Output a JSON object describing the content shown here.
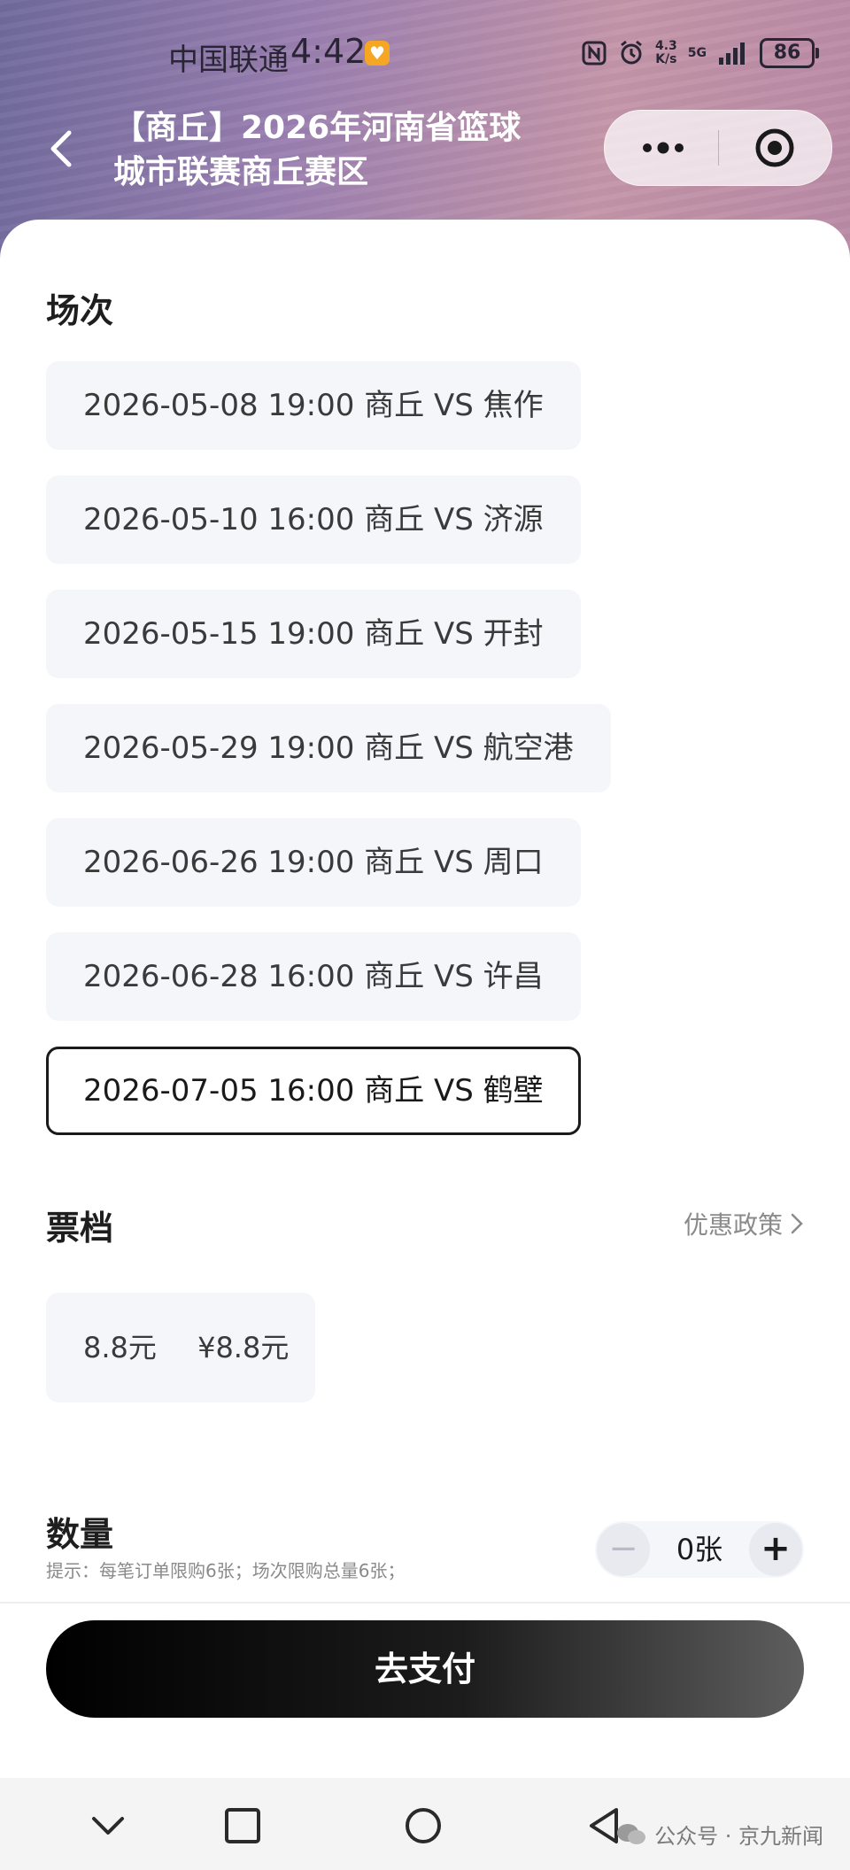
{
  "status_bar": {
    "carrier": "中国联通",
    "time": "4:42",
    "speed_top": "4.3",
    "speed_bottom": "K/s",
    "network": "5G",
    "battery": "86"
  },
  "nav": {
    "title_line1": "【商丘】2026年河南省篮球",
    "title_line2": "城市联赛商丘赛区",
    "icons": [
      "chevron-left-icon",
      "more-icon",
      "target-icon"
    ]
  },
  "sessions": {
    "title": "场次",
    "items": [
      {
        "label": "2026-05-08 19:00 商丘 VS 焦作",
        "selected": false
      },
      {
        "label": "2026-05-10 16:00 商丘 VS 济源",
        "selected": false
      },
      {
        "label": "2026-05-15 19:00 商丘 VS 开封",
        "selected": false
      },
      {
        "label": "2026-05-29 19:00 商丘 VS 航空港",
        "selected": false
      },
      {
        "label": "2026-06-26 19:00 商丘 VS 周口",
        "selected": false
      },
      {
        "label": "2026-06-28 16:00 商丘 VS 许昌",
        "selected": false
      },
      {
        "label": "2026-07-05 16:00 商丘 VS 鹤壁",
        "selected": true
      }
    ]
  },
  "tickets": {
    "title": "票档",
    "policy_link": "优惠政策",
    "tiers": [
      {
        "name": "8.8元",
        "price": "¥8.8元"
      }
    ]
  },
  "quantity": {
    "title": "数量",
    "hint": "提示：每笔订单限购6张；场次限购总量6张；",
    "value": "0张",
    "minus": "−",
    "plus": "+"
  },
  "pay_button": "去支付",
  "watermark": "公众号 · 京九新闻",
  "colors": {
    "accent": "#000000",
    "chip_bg": "#f4f6fa",
    "header_from": "#6f6a9c",
    "header_to": "#c495a8"
  }
}
